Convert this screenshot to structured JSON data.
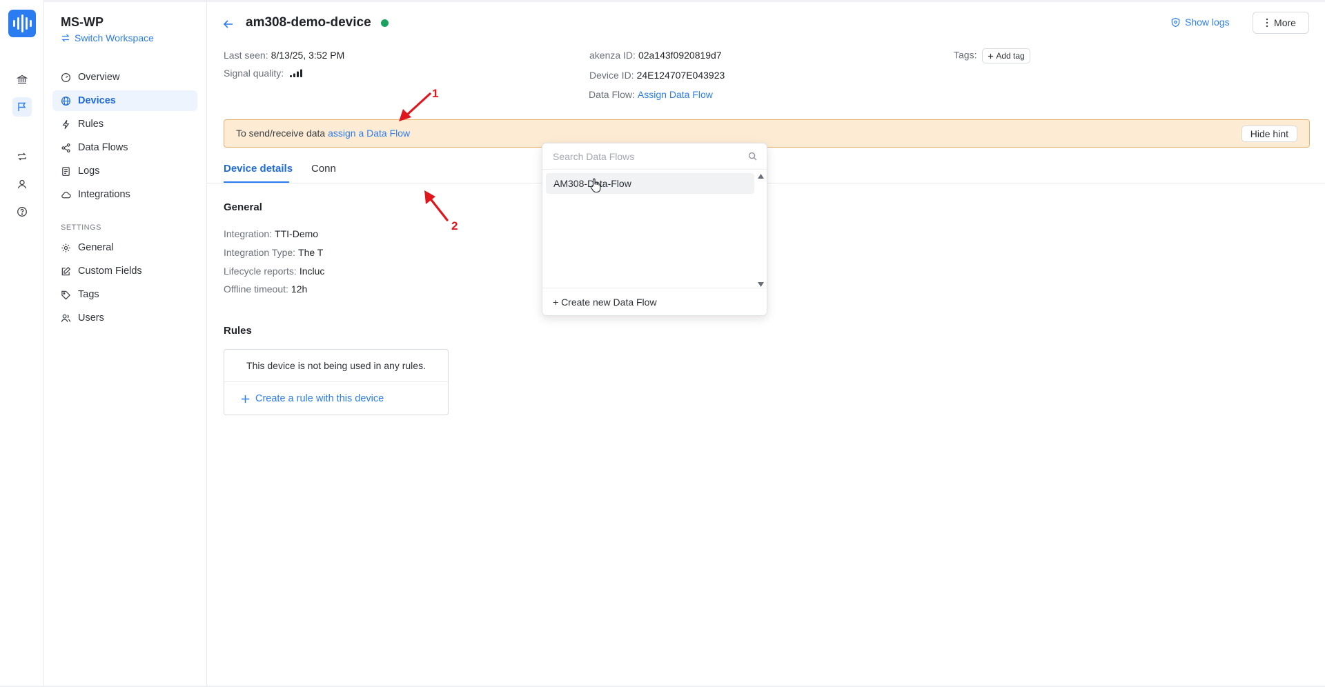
{
  "workspace": {
    "name": "MS-WP",
    "switch_label": "Switch Workspace"
  },
  "nav": {
    "items": [
      {
        "label": "Overview",
        "icon": "gauge-icon"
      },
      {
        "label": "Devices",
        "icon": "globe-icon",
        "active": true
      },
      {
        "label": "Rules",
        "icon": "bolt-icon"
      },
      {
        "label": "Data Flows",
        "icon": "share-icon"
      },
      {
        "label": "Logs",
        "icon": "log-icon"
      },
      {
        "label": "Integrations",
        "icon": "cloud-icon"
      }
    ],
    "settings_label": "SETTINGS",
    "settings_items": [
      {
        "label": "General",
        "icon": "gear-icon"
      },
      {
        "label": "Custom Fields",
        "icon": "edit-icon"
      },
      {
        "label": "Tags",
        "icon": "tag-icon"
      },
      {
        "label": "Users",
        "icon": "users-icon"
      }
    ]
  },
  "device": {
    "name": "am308-demo-device",
    "status_color": "#1aa260",
    "last_seen_label": "Last seen:",
    "last_seen": "8/13/25, 3:52 PM",
    "signal_label": "Signal quality:",
    "akenza_id_label": "akenza ID:",
    "akenza_id": "02a143f0920819d7",
    "device_id_label": "Device ID:",
    "device_id": "24E124707E043923",
    "data_flow_label": "Data Flow:",
    "data_flow_link": "Assign Data Flow",
    "tags_label": "Tags:",
    "add_tag": "Add tag"
  },
  "header": {
    "show_logs": "Show logs",
    "more": "More"
  },
  "hint": {
    "text": "To send/receive data",
    "link": "assign a Data Flow",
    "button": "Hide hint"
  },
  "tabs": [
    {
      "label": "Device details",
      "active": true
    },
    {
      "label": "Conn"
    }
  ],
  "general": {
    "title": "General",
    "rows": [
      {
        "label": "Integration:",
        "value": "TTI-Demo"
      },
      {
        "label": "Integration Type:",
        "value": "The T"
      },
      {
        "label": "Lifecycle reports:",
        "value": "Incluc"
      },
      {
        "label": "Offline timeout:",
        "value": "12h"
      }
    ]
  },
  "rules": {
    "title": "Rules",
    "empty_text": "This device is not being used in any rules.",
    "create_label": "Create a rule with this device"
  },
  "dropdown": {
    "search_placeholder": "Search Data Flows",
    "options": [
      "AM308-Data-Flow"
    ],
    "footer": "+ Create new Data Flow"
  },
  "annotations": [
    {
      "label": "1"
    },
    {
      "label": "2"
    }
  ],
  "colors": {
    "accent": "#2b7cf0",
    "hint_bg": "#fdebd3",
    "annotation": "#e0161d"
  }
}
